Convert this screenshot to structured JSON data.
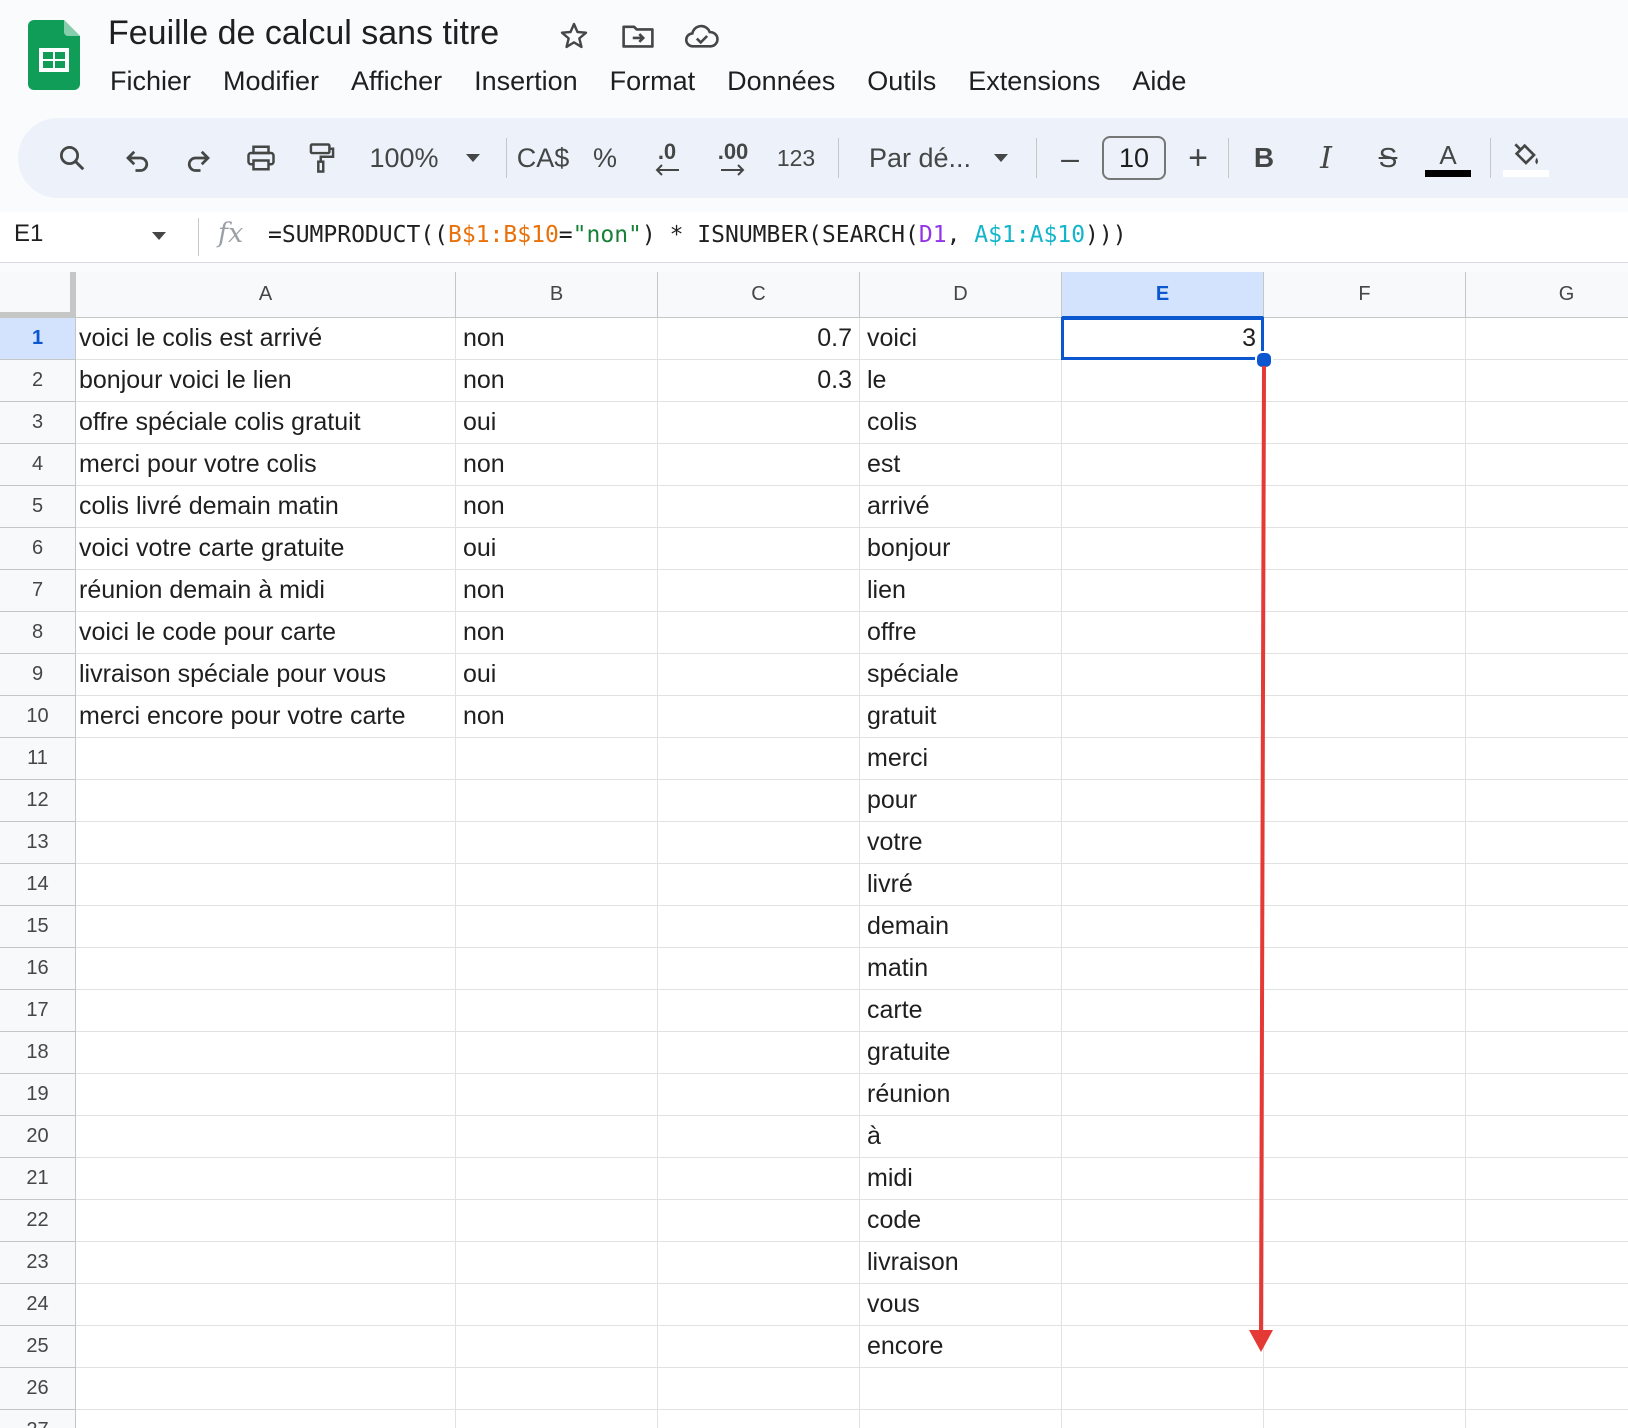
{
  "app": {
    "title": "Feuille de calcul sans titre",
    "icons": [
      "sheets-logo-icon",
      "star-icon",
      "move-folder-icon",
      "cloud-saved-icon"
    ]
  },
  "menu": [
    "Fichier",
    "Modifier",
    "Afficher",
    "Insertion",
    "Format",
    "Données",
    "Outils",
    "Extensions",
    "Aide"
  ],
  "toolbar": {
    "zoom": "100%",
    "currency": "CA$",
    "percent": "%",
    "decrease_decimal": ".0",
    "increase_decimal": ".00",
    "number_format": "123",
    "font": "Par dé...",
    "font_size": "10",
    "minus": "–",
    "plus": "+",
    "bold": "B",
    "italic": "I",
    "strike": "S",
    "text_color": "A"
  },
  "formula_bar": {
    "cell_ref": "E1",
    "fx": "fx",
    "formula_parts": [
      {
        "text": "=SUMPRODUCT((",
        "color": "#1f1f1f"
      },
      {
        "text": "B$1:B$10",
        "color": "#e8710a"
      },
      {
        "text": "=",
        "color": "#1f1f1f"
      },
      {
        "text": "\"non\"",
        "color": "#188038"
      },
      {
        "text": ") * ISNUMBER(SEARCH(",
        "color": "#1f1f1f"
      },
      {
        "text": "D1",
        "color": "#9334e6"
      },
      {
        "text": ", ",
        "color": "#1f1f1f"
      },
      {
        "text": "A$1:A$10",
        "color": "#12b5cb"
      },
      {
        "text": ")))",
        "color": "#1f1f1f"
      }
    ]
  },
  "grid": {
    "columns": [
      "A",
      "B",
      "C",
      "D",
      "E",
      "F",
      "G"
    ],
    "selected_column": "E",
    "selected_row": "1",
    "row_numbers": [
      "1",
      "2",
      "3",
      "4",
      "5",
      "6",
      "7",
      "8",
      "9",
      "10",
      "11",
      "12",
      "13",
      "14",
      "15",
      "16",
      "17",
      "18",
      "19",
      "20",
      "21",
      "22",
      "23",
      "24",
      "25",
      "26",
      "27"
    ],
    "col_A": [
      "voici le colis est arrivé",
      "bonjour voici le lien",
      "offre spéciale colis gratuit",
      "merci pour votre colis",
      "colis livré demain matin",
      "voici votre carte gratuite",
      "réunion demain à midi",
      "voici le code pour carte",
      "livraison spéciale pour vous",
      "merci encore pour votre carte"
    ],
    "col_B": [
      "non",
      "non",
      "oui",
      "non",
      "non",
      "oui",
      "non",
      "non",
      "oui",
      "non"
    ],
    "col_C": [
      "0.7",
      "0.3"
    ],
    "col_D": [
      "voici",
      "le",
      "colis",
      "est",
      "arrivé",
      "bonjour",
      "lien",
      "offre",
      "spéciale",
      "gratuit",
      "merci",
      "pour",
      "votre",
      "livré",
      "demain",
      "matin",
      "carte",
      "gratuite",
      "réunion",
      "à",
      "midi",
      "code",
      "livraison",
      "vous",
      "encore"
    ],
    "col_E": [
      "3"
    ]
  },
  "annotation": {
    "type": "arrow",
    "color": "#e53935",
    "meaning": "drag fill handle down"
  },
  "colors": {
    "accent": "#0b57d0",
    "selection_header": "#d3e3fd",
    "sheets_green": "#0f9d58"
  }
}
